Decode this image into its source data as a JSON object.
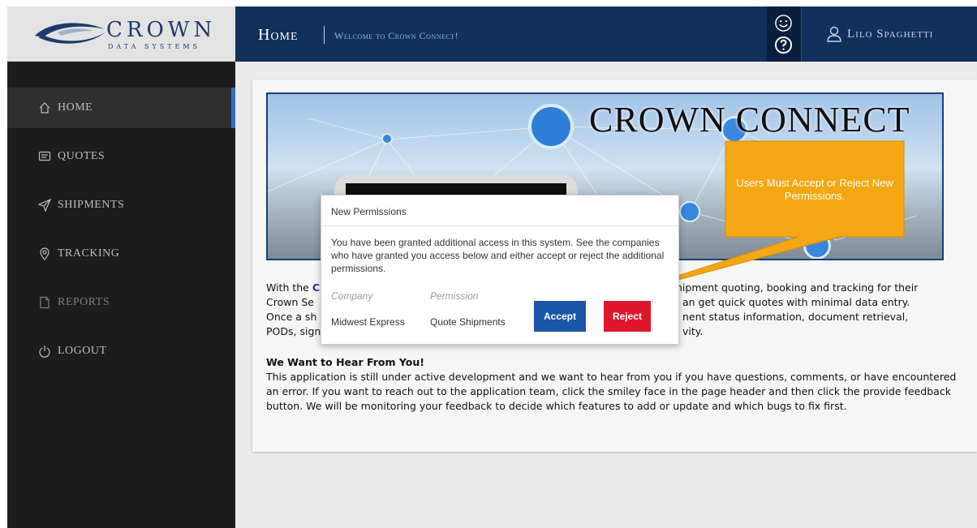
{
  "brand": {
    "name": "CROWN",
    "sub": "DATA SYSTEMS"
  },
  "header": {
    "title": "Home",
    "subtitle": "Welcome to Crown Connect!",
    "user": "Lilo Spaghetti"
  },
  "sidebar": {
    "items": [
      {
        "label": "HOME",
        "icon": "home-icon"
      },
      {
        "label": "QUOTES",
        "icon": "message-icon"
      },
      {
        "label": "SHIPMENTS",
        "icon": "send-icon"
      },
      {
        "label": "TRACKING",
        "icon": "location-pin-icon"
      },
      {
        "label": "REPORTS",
        "icon": "document-icon"
      },
      {
        "label": "LOGOUT",
        "icon": "power-icon"
      }
    ]
  },
  "banner": {
    "title": "CROWN CONNECT"
  },
  "content": {
    "p1_lead": "With the ",
    "p1_a": "C",
    "p1_line1_right": "hipment quoting, booking and tracking for their",
    "p1_line2_left": "Crown Se",
    "p1_line2_right": "an get quick quotes with minimal data entry.",
    "p1_line3_left": "Once a sh",
    "p1_line3_right": "nent status information, document retrieval,",
    "p1_line4_left": "PODs, sign",
    "p1_line4_right": "vity.",
    "heading": "We Want to Hear From You!",
    "p2": "This application is still under active development and we want to hear from you if you have questions, comments, or have encountered an error. If you want to reach out to the application team, click the smiley face in the page header and then click the provide feedback button. We will be monitoring your feedback to decide which features to add or update and which bugs to fix first."
  },
  "modal": {
    "title": "New Permissions",
    "message": "You have been granted additional access in this system. See the companies who have granted you access below and either accept or reject the additional permissions.",
    "col_company": "Company",
    "col_permission": "Permission",
    "company": "Midwest Express",
    "permission": "Quote Shipments",
    "accept": "Accept",
    "reject": "Reject"
  },
  "callout": {
    "text": "Users Must Accept or Reject New Permissions."
  },
  "colors": {
    "header": "#11305c",
    "sidebar": "#1c1c1c",
    "accent": "#2c6fc9",
    "accept": "#1b55a8",
    "reject": "#e0172c",
    "callout": "#f3a712"
  }
}
